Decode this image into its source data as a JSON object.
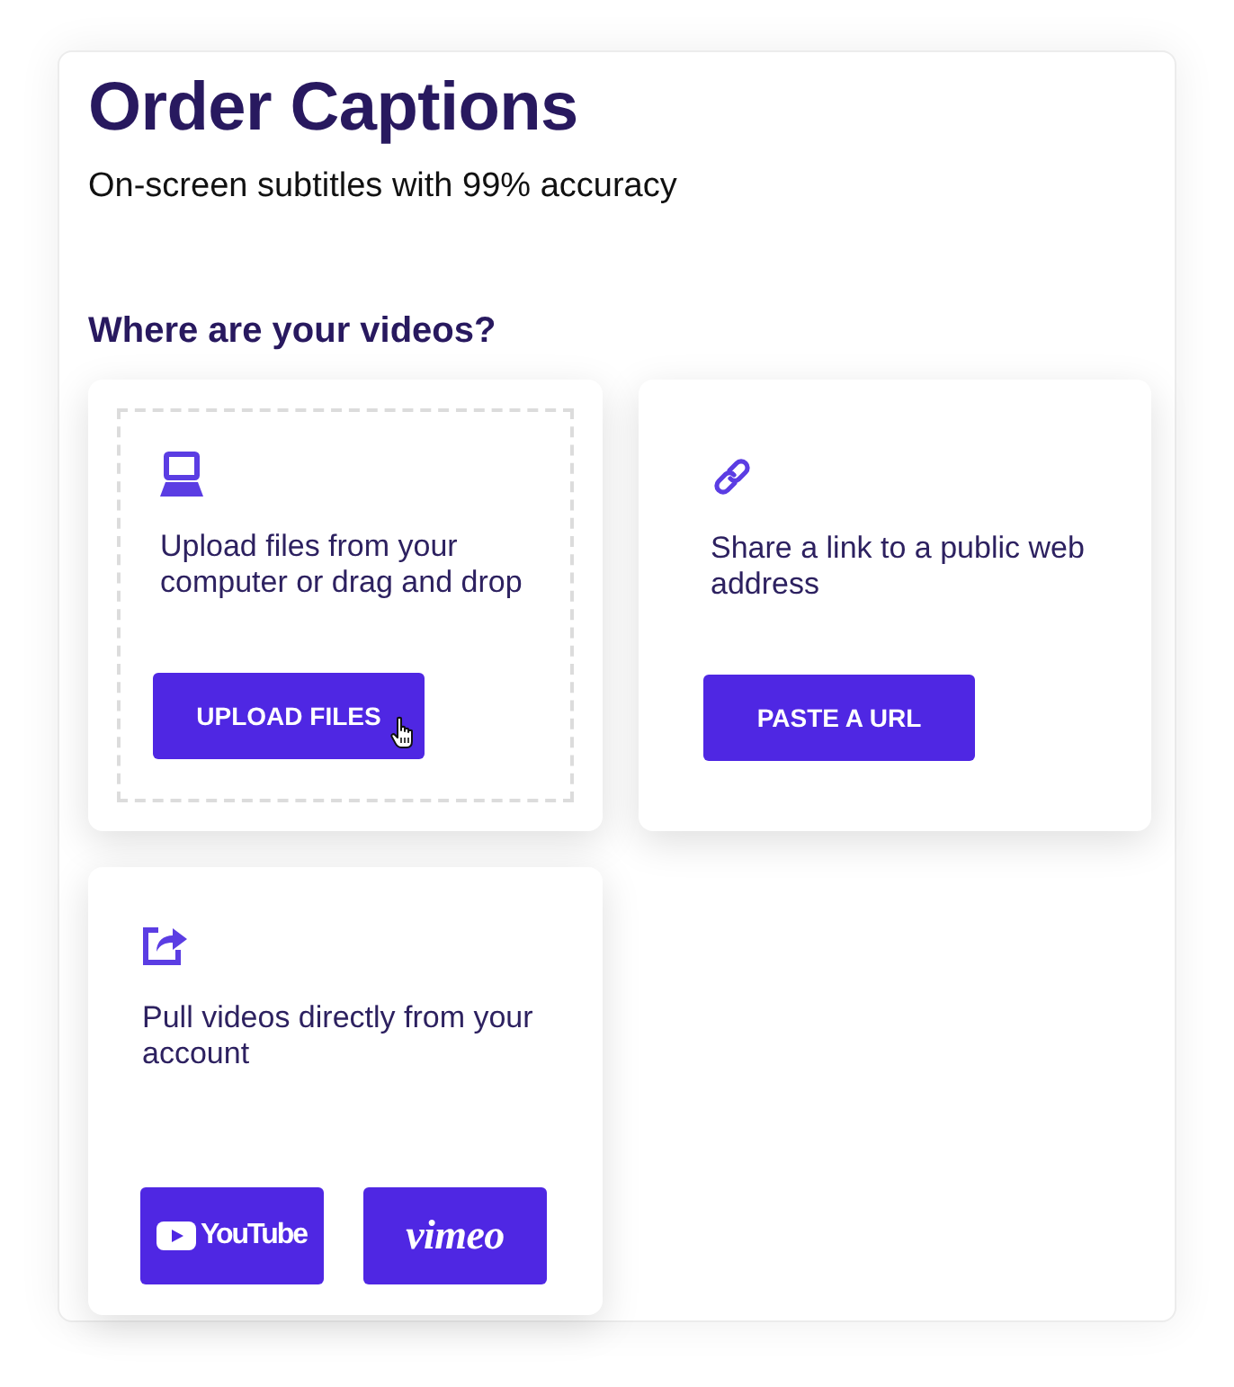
{
  "header": {
    "title": "Order Captions",
    "subtitle": "On-screen subtitles with 99% accuracy"
  },
  "sources": {
    "heading": "Where are your videos?",
    "cards": [
      {
        "kind": "upload",
        "text": "Upload files from your computer or drag and drop",
        "button": {
          "label": "UPLOAD FILES",
          "hovered": true
        }
      },
      {
        "kind": "link",
        "text": "Share a link to a public web address",
        "button": {
          "label": "PASTE A URL",
          "hovered": false
        }
      },
      {
        "kind": "account",
        "text": "Pull videos directly from your account",
        "services": [
          {
            "kind": "youtube",
            "label": "YouTube"
          },
          {
            "kind": "vimeo",
            "label": "vimeo"
          }
        ]
      }
    ]
  }
}
